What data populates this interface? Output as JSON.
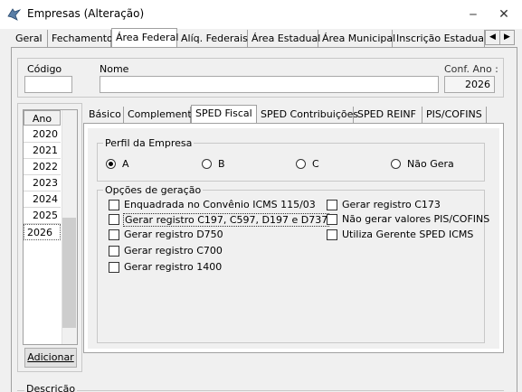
{
  "window": {
    "title": "Empresas (Alteração)",
    "minimize": "‒",
    "close": "✕"
  },
  "top_tabs": [
    "Geral",
    "Fechamento",
    "Área Federal",
    "Alíq. Federais",
    "Área Estadual",
    "Área Municipal",
    "Inscrição Estadual S"
  ],
  "tab_scroll": {
    "left": "◀",
    "right": "▶"
  },
  "header": {
    "codigo_label": "Código",
    "nome_label": "Nome",
    "conf_ano_label": "Conf. Ano :",
    "conf_ano_value": "2026"
  },
  "years": {
    "header": "Ano",
    "items": [
      "2020",
      "2021",
      "2022",
      "2023",
      "2024",
      "2025",
      "2026"
    ],
    "add_button": "Adicionar"
  },
  "sub_tabs": [
    "Básico",
    "Complemento",
    "SPED Fiscal",
    "SPED Contribuições",
    "SPED REINF",
    "PIS/COFINS"
  ],
  "perfil": {
    "title": "Perfil da Empresa",
    "options": [
      "A",
      "B",
      "C",
      "Não Gera"
    ],
    "selected": "A"
  },
  "opcoes": {
    "title": "Opções de geração",
    "left": [
      "Enquadrada no Convênio ICMS 115/03",
      "Gerar registro C197, C597, D197 e D737",
      "Gerar registro D750",
      "Gerar registro C700",
      "Gerar registro 1400"
    ],
    "right": [
      "Gerar registro C173",
      "Não gerar valores PIS/COFINS",
      "Utiliza Gerente SPED ICMS"
    ]
  },
  "footer": {
    "descricao_label": "Descrição"
  },
  "colors": {
    "accent": "#0078d7",
    "window_bg": "#f0f0f0"
  }
}
